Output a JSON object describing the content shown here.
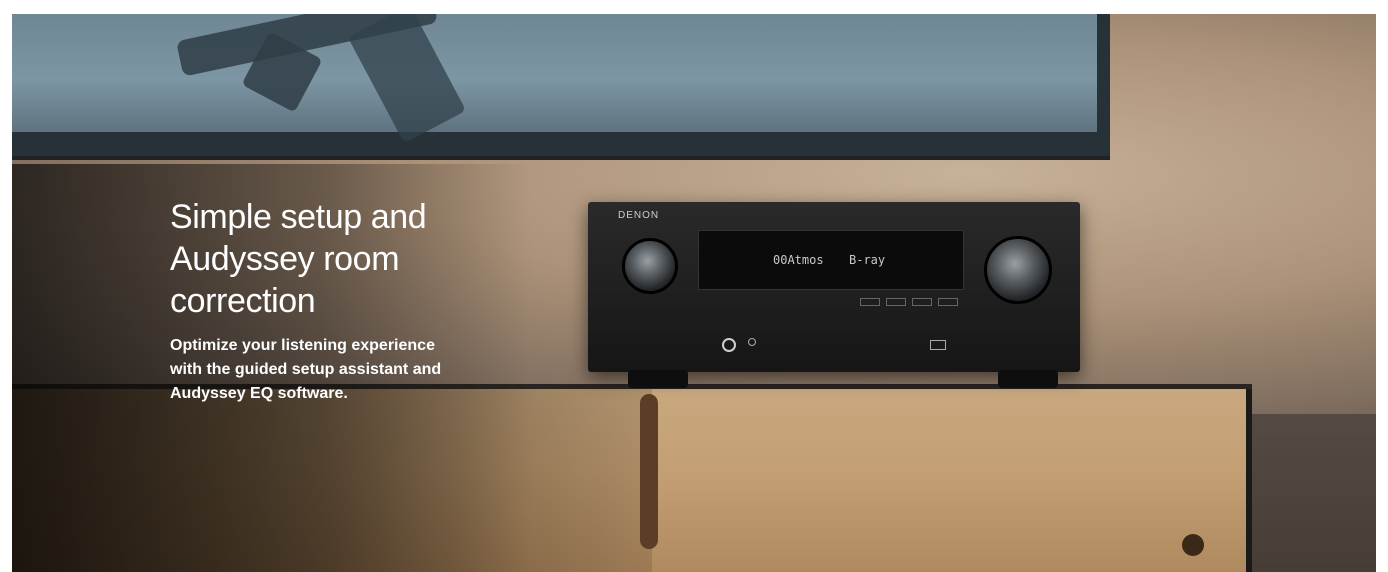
{
  "banner": {
    "headline": "Simple setup and Audyssey room correction",
    "body": "Optimize your listening experience with the guided setup assistant and Audyssey EQ software."
  },
  "receiver": {
    "brand": "DENON",
    "display_left": "00Atmos",
    "display_right": "B-ray"
  }
}
